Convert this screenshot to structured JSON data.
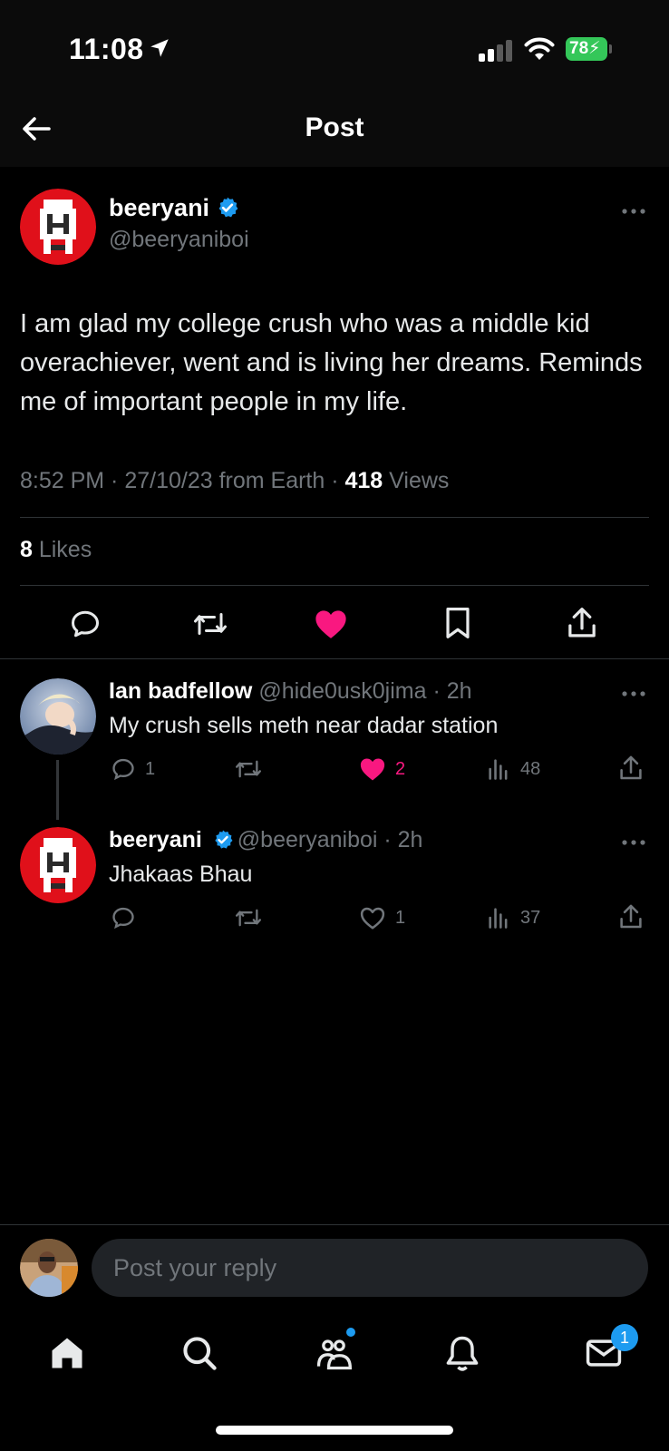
{
  "status_bar": {
    "time": "11:08",
    "battery": "78",
    "icons": [
      "location-arrow-icon",
      "signal-icon",
      "wifi-icon",
      "battery-charging-icon"
    ]
  },
  "header": {
    "title": "Post",
    "back_icon": "back-arrow-icon"
  },
  "post": {
    "name": "beeryani",
    "handle": "@beeryaniboi",
    "verified": true,
    "text": "I am glad my college crush who was a middle kid overachiever, went and is living her dreams. Reminds me of important people in my life.",
    "meta_prefix": "8:52 PM · 27/10/23 from Earth · ",
    "views_count": "418",
    "views_label": " Views",
    "likes_count": "8",
    "likes_label": " Likes",
    "liked": true,
    "actions": [
      "reply-icon",
      "repost-icon",
      "like-icon",
      "bookmark-icon",
      "share-icon"
    ],
    "colors": {
      "like": "#f91880",
      "verified": "#1d9bf0"
    }
  },
  "replies": [
    {
      "name": "Ian badfellow",
      "handle": "@hide0usk0jima",
      "time": " · 2h",
      "text": "My crush sells meth near dadar station",
      "reply_count": "1",
      "like_count": "2",
      "view_count": "48",
      "liked": true
    },
    {
      "name": "beeryani",
      "handle": "@beeryaniboi",
      "time": " · 2h",
      "text": "Jhakaas Bhau",
      "reply_count": "",
      "like_count": "1",
      "view_count": "37",
      "liked": false,
      "verified": true
    }
  ],
  "composer": {
    "placeholder": "Post your reply"
  },
  "bottom_nav": {
    "items": [
      "home-icon",
      "search-icon",
      "communities-icon",
      "notifications-icon",
      "messages-icon"
    ],
    "messages_badge": "1"
  }
}
